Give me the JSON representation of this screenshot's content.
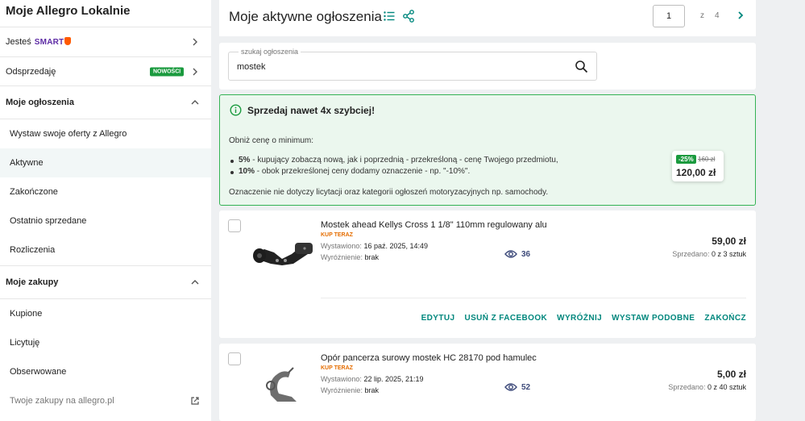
{
  "sidebar": {
    "title": "Moje Allegro Lokalnie",
    "jestes_label": "Jesteś",
    "smart_label": "SMART",
    "odsprzedaje_label": "Odsprzedaję",
    "new_badge": "NOWOŚCI",
    "section_ogloszenia": "Moje ogłoszenia",
    "items_ogloszenia": [
      {
        "label": "Wystaw swoje oferty z Allegro"
      },
      {
        "label": "Aktywne"
      },
      {
        "label": "Zakończone"
      },
      {
        "label": "Ostatnio sprzedane"
      },
      {
        "label": "Rozliczenia"
      }
    ],
    "section_zakupy": "Moje zakupy",
    "items_zakupy": [
      {
        "label": "Kupione"
      },
      {
        "label": "Licytuję"
      },
      {
        "label": "Obserwowane"
      }
    ],
    "external_link": "Twoje zakupy na allegro.pl"
  },
  "header": {
    "title": "Moje aktywne ogłoszenia",
    "current_page": "1",
    "of_label": "z",
    "total_pages": "4"
  },
  "search": {
    "legend": "szukaj ogłoszenia",
    "value": "mostek"
  },
  "promo": {
    "title": "Sprzedaj nawet 4x szybciej!",
    "intro": "Obniż cenę o minimum:",
    "bullets": [
      {
        "bold": "5%",
        "text": " - kupujący zobaczą nową, jak i poprzednią - przekreśloną - cenę Twojego przedmiotu,"
      },
      {
        "bold": "10%",
        "text": " - obok przekreślonej ceny dodamy oznaczenie - np. \"-10%\"."
      }
    ],
    "note": "Oznaczenie nie dotyczy licytacji oraz kategorii ogłoszeń motoryzacyjnych np. samochody.",
    "discount": "-25%",
    "old_price": "160 zł",
    "new_price": "120,00 zł"
  },
  "offers": [
    {
      "title": "Mostek ahead Kellys Cross 1 1/8\" 110mm regulowany alu",
      "type": "KUP TERAZ",
      "listed_label": "Wystawiono:",
      "listed_value": "16 paź. 2025, 14:49",
      "featured_label": "Wyróżnienie:",
      "featured_value": "brak",
      "views": "36",
      "price": "59,00 zł",
      "sold_label": "Sprzedano:",
      "sold_value": "0 z 3 sztuk"
    },
    {
      "title": "Opór pancerza surowy mostek HC 28170 pod hamulec",
      "type": "KUP TERAZ",
      "listed_label": "Wystawiono:",
      "listed_value": "22 lip. 2025, 21:19",
      "featured_label": "Wyróżnienie:",
      "featured_value": "brak",
      "views": "52",
      "price": "5,00 zł",
      "sold_label": "Sprzedano:",
      "sold_value": "0 z 40 sztuk"
    }
  ],
  "actions": {
    "edit": "EDYTUJ",
    "remove_fb": "USUŃ Z FACEBOOK",
    "feature": "WYRÓŻNIJ",
    "similar": "WYSTAW PODOBNE",
    "end": "ZAKOŃCZ"
  },
  "colors": {
    "accent": "#00877d",
    "promo_bg": "#ebf7ee",
    "promo_border": "#34b354",
    "badge_green": "#1a9a3e",
    "smart_purple": "#5e2ca5",
    "kup_teraz_orange": "#e56d00"
  },
  "icons": {
    "list_view": "list-icon",
    "share": "share-icon",
    "search": "search-icon",
    "info": "info-icon",
    "eye": "eye-icon",
    "external": "external-link-icon"
  }
}
